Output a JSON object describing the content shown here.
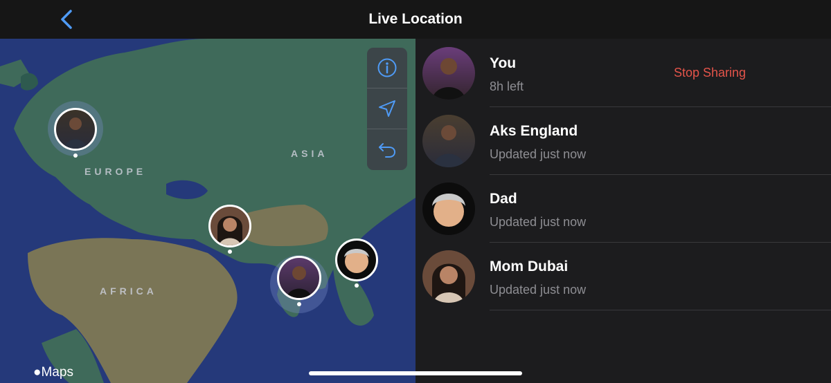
{
  "header": {
    "title": "Live Location",
    "back_icon": "chevron-left-icon"
  },
  "map": {
    "regions": {
      "europe": "EUROPE",
      "asia": "ASIA",
      "africa": "AFRICA"
    },
    "controls": [
      "info-icon",
      "location-arrow-icon",
      "undo-icon"
    ],
    "attribution": "Maps",
    "colors": {
      "water": "#25397a",
      "land": "#3f6a5a",
      "desert": "#7a7556",
      "accent": "#4f9bf6"
    }
  },
  "people": [
    {
      "name": "You",
      "status": "8h left",
      "action": "Stop Sharing"
    },
    {
      "name": "Aks England",
      "status": "Updated just now"
    },
    {
      "name": "Dad",
      "status": "Updated just now"
    },
    {
      "name": "Mom Dubai",
      "status": "Updated just now"
    }
  ],
  "colors": {
    "stop_sharing": "#e4544a",
    "panel_bg": "#1c1c1e",
    "secondary_text": "#8e8e93"
  }
}
